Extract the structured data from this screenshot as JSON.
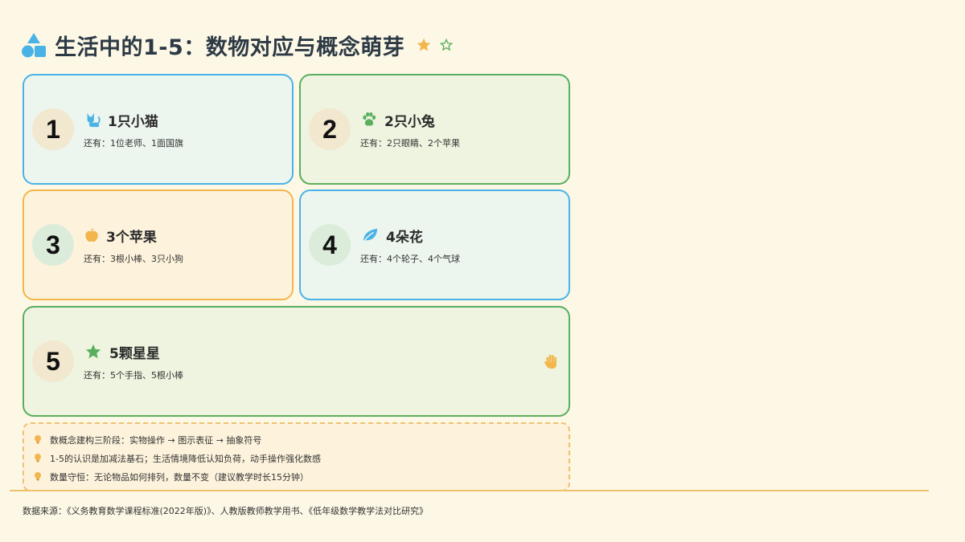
{
  "header": {
    "title": "生活中的1-5：数物对应与概念萌芽",
    "icons": [
      "shapes-icon",
      "star-icon",
      "star-outline-icon"
    ]
  },
  "colors": {
    "blue": "#4ab3e6",
    "green": "#5aae5f",
    "orange": "#f2b64d",
    "background": "#fdf8e6"
  },
  "cards": [
    {
      "number": "1",
      "label": "1只小猫",
      "also": "还有：1位老师、1面国旗",
      "icon": "cat-icon"
    },
    {
      "number": "2",
      "label": "2只小兔",
      "also": "还有：2只眼睛、2个苹果",
      "icon": "paw-icon"
    },
    {
      "number": "3",
      "label": "3个苹果",
      "also": "还有：3根小棒、3只小狗",
      "icon": "apple-icon"
    },
    {
      "number": "4",
      "label": "4朵花",
      "also": "还有：4个轮子、4个气球",
      "icon": "leaf-icon"
    },
    {
      "number": "5",
      "label": "5颗星星",
      "also": "还有：5个手指、5根小棒",
      "icon": "star-icon",
      "extra_icon": "hand-icon"
    }
  ],
  "notes": [
    "数概念建构三阶段：实物操作 → 图示表征 → 抽象符号",
    "1-5的认识是加减法基石；生活情境降低认知负荷，动手操作强化数感",
    "数量守恒：无论物品如何排列，数量不变（建议教学时长15分钟）"
  ],
  "footer": {
    "source": "数据来源：《义务教育数学课程标准(2022年版)》、人教版教师教学用书、《低年级数学教学法对比研究》"
  }
}
